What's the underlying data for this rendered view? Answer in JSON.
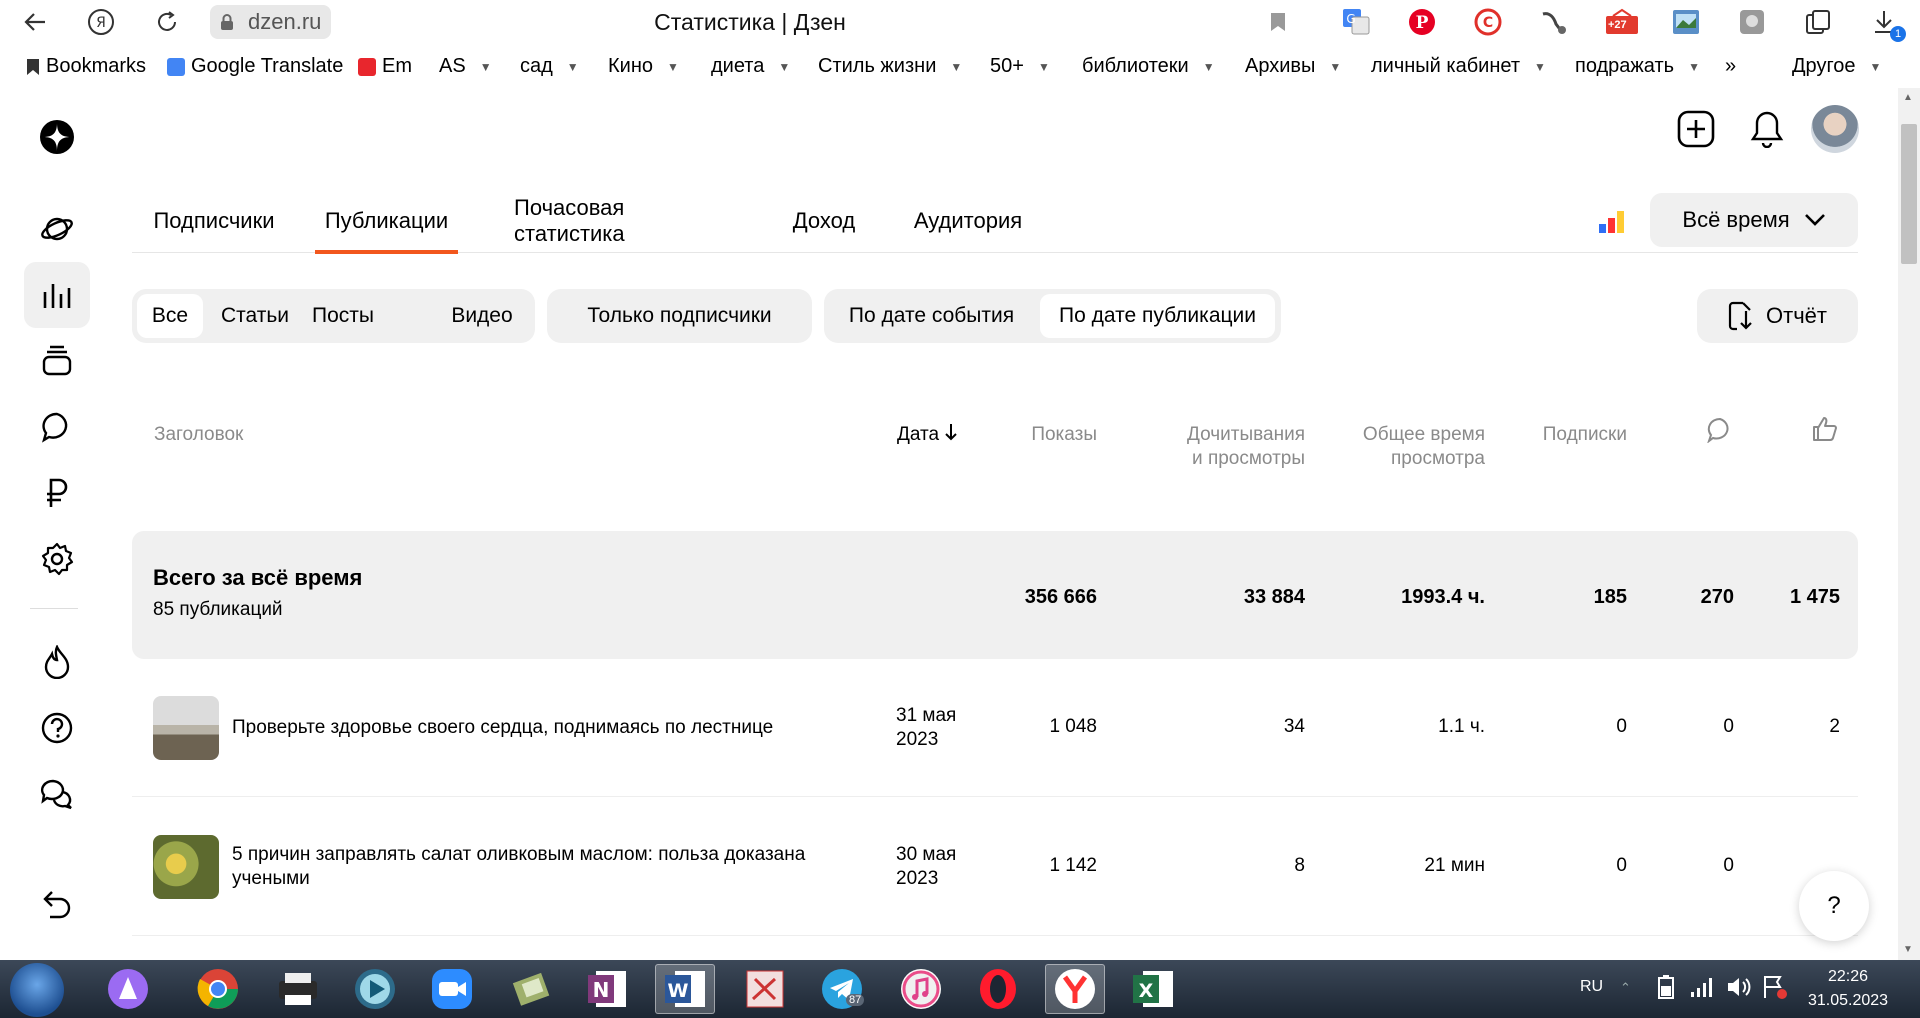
{
  "browser": {
    "url": "dzen.ru",
    "tab_title": "Статистика | Дзен",
    "download_badge": "1",
    "ext_badge": "+27",
    "bookmarks": [
      {
        "label": "Bookmarks",
        "dropdown": false
      },
      {
        "label": "Google Translate",
        "dropdown": false
      },
      {
        "label": "Em",
        "dropdown": false
      },
      {
        "label": "AS",
        "dropdown": true
      },
      {
        "label": "сад",
        "dropdown": true
      },
      {
        "label": "Кино",
        "dropdown": true
      },
      {
        "label": "диета",
        "dropdown": true
      },
      {
        "label": "Стиль жизни",
        "dropdown": true
      },
      {
        "label": "50+",
        "dropdown": true
      },
      {
        "label": "библиотеки",
        "dropdown": true
      },
      {
        "label": "Архивы",
        "dropdown": true
      },
      {
        "label": "личный кабинет",
        "dropdown": true
      },
      {
        "label": "подражать",
        "dropdown": true
      }
    ],
    "bookmarks_more": "»",
    "other_bookmarks": "Другое"
  },
  "tabs": [
    "Подписчики",
    "Публикации",
    "Почасовая статистика",
    "Доход",
    "Аудитория"
  ],
  "active_tab": "Публикации",
  "period": "Всё время",
  "filters": {
    "types": [
      "Все",
      "Статьи",
      "Посты",
      "Видео"
    ],
    "active_type": "Все",
    "subscribers_only": "Только подписчики",
    "date_modes": [
      "По дате события",
      "По дате публикации"
    ],
    "active_date_mode": "По дате публикации",
    "report": "Отчёт"
  },
  "table": {
    "headers": {
      "title": "Заголовок",
      "date": "Дата",
      "views": "Показы",
      "reads_1": "Дочитывания",
      "reads_2": "и просмотры",
      "time_1": "Общее время",
      "time_2": "просмотра",
      "subs": "Подписки"
    },
    "totals": {
      "title": "Всего за всё время",
      "subtitle": "85 публикаций",
      "views": "356 666",
      "reads": "33 884",
      "time": "1993.4 ч.",
      "subs": "185",
      "comments": "270",
      "likes": "1 475"
    },
    "rows": [
      {
        "title": "Проверьте здоровье своего сердца, поднимаясь по лестнице",
        "date_1": "31 мая",
        "date_2": "2023",
        "views": "1 048",
        "reads": "34",
        "time": "1.1 ч.",
        "subs": "0",
        "comments": "0",
        "likes": "2"
      },
      {
        "title": "5 причин заправлять салат оливковым маслом: польза доказана учеными",
        "date_1": "30 мая",
        "date_2": "2023",
        "views": "1 142",
        "reads": "8",
        "time": "21 мин",
        "subs": "0",
        "comments": "0",
        "likes": ""
      }
    ]
  },
  "help": "?",
  "taskbar": {
    "lang": "RU",
    "time": "22:26",
    "date": "31.05.2023",
    "telegram_badge": "87"
  },
  "colors": {
    "accent": "#f2571d",
    "panel": "#f0f0f0"
  }
}
